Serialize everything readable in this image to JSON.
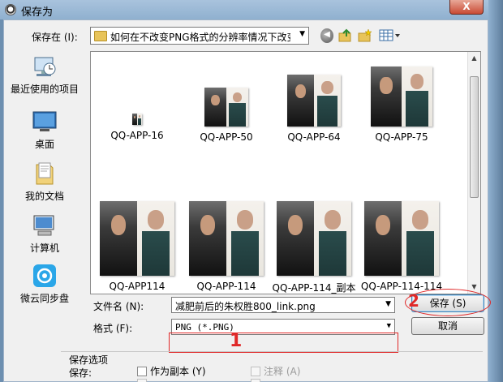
{
  "window": {
    "title": "保存为",
    "close_glyph": "X"
  },
  "toolbar": {
    "save_in_label": "保存在 (I):",
    "path_value": "如何在不改变PNG格式的分辨率情况下改变",
    "back_glyph": "◀"
  },
  "places": [
    {
      "label": "最近使用的项目",
      "icon": "recent-items-icon"
    },
    {
      "label": "桌面",
      "icon": "desktop-icon"
    },
    {
      "label": "我的文档",
      "icon": "documents-icon"
    },
    {
      "label": "计算机",
      "icon": "computer-icon"
    },
    {
      "label": "微云同步盘",
      "icon": "weiyun-icon"
    }
  ],
  "files": [
    {
      "name": "QQ-APP-16"
    },
    {
      "name": "QQ-APP-50"
    },
    {
      "name": "QQ-APP-64"
    },
    {
      "name": "QQ-APP-75"
    },
    {
      "name": "QQ-APP114"
    },
    {
      "name": "QQ-APP-114"
    },
    {
      "name": "QQ-APP-114_副本"
    },
    {
      "name": "QQ-APP-114-114"
    }
  ],
  "form": {
    "filename_label": "文件名 (N):",
    "filename_value": "减肥前后的朱权胜800_link.png",
    "format_label": "格式 (F):",
    "format_value": "PNG (*.PNG)",
    "save_button": "保存 (S)",
    "cancel_button": "取消"
  },
  "annotations": {
    "marker_1": "1",
    "marker_2": "2",
    "color": "#e02828"
  },
  "save_options": {
    "group_title": "保存选项",
    "save_label": "保存:",
    "as_copy": "作为副本 (Y)",
    "notes": "注释 (A)"
  }
}
